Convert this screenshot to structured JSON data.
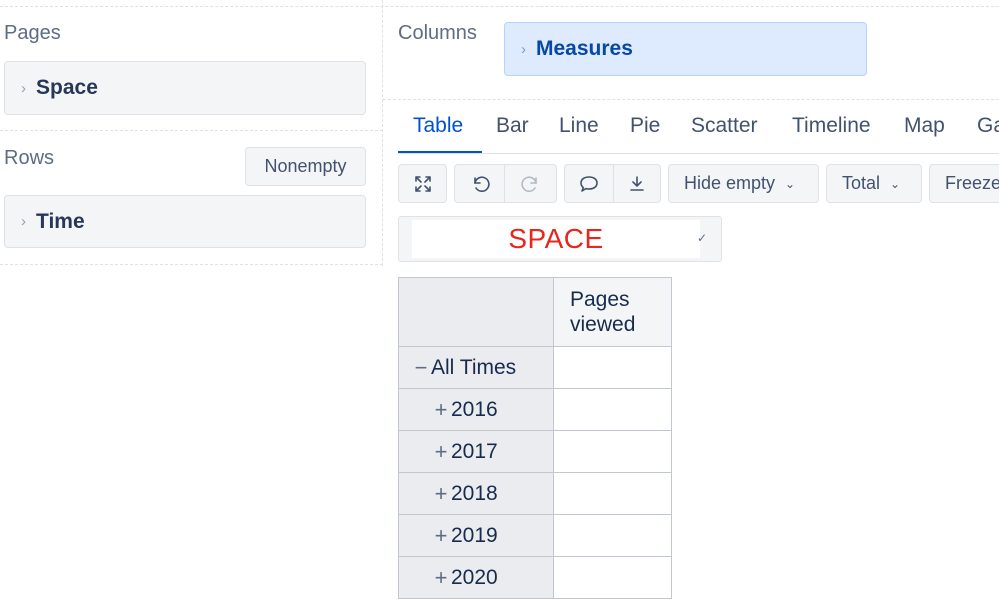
{
  "pages": {
    "title": "Pages",
    "item": "Space"
  },
  "rows": {
    "title": "Rows",
    "nonempty_label": "Nonempty",
    "item": "Time"
  },
  "columns": {
    "title": "Columns",
    "item": "Measures"
  },
  "tabs": [
    "Table",
    "Bar",
    "Line",
    "Pie",
    "Scatter",
    "Timeline",
    "Map",
    "Ga"
  ],
  "toolbar": {
    "hide_empty_label": "Hide empty",
    "total_label": "Total",
    "freeze_label": "Freeze",
    "icons": [
      "fullscreen-icon",
      "undo-icon",
      "redo-icon",
      "comment-icon",
      "export-icon",
      "chevron-down-icon"
    ]
  },
  "page_selector": {
    "value": "SPACE"
  },
  "table": {
    "column_header": "Pages viewed",
    "rows": [
      {
        "symbol": "−",
        "label": "All Times",
        "value": ""
      },
      {
        "symbol": "+",
        "label": "2016",
        "value": ""
      },
      {
        "symbol": "+",
        "label": "2017",
        "value": ""
      },
      {
        "symbol": "+",
        "label": "2018",
        "value": ""
      },
      {
        "symbol": "+",
        "label": "2019",
        "value": ""
      },
      {
        "symbol": "+",
        "label": "2020",
        "value": ""
      }
    ]
  },
  "colors": {
    "accent": "#0052cc",
    "selector_text": "#e8261d",
    "measures_bg": "#deebff"
  }
}
